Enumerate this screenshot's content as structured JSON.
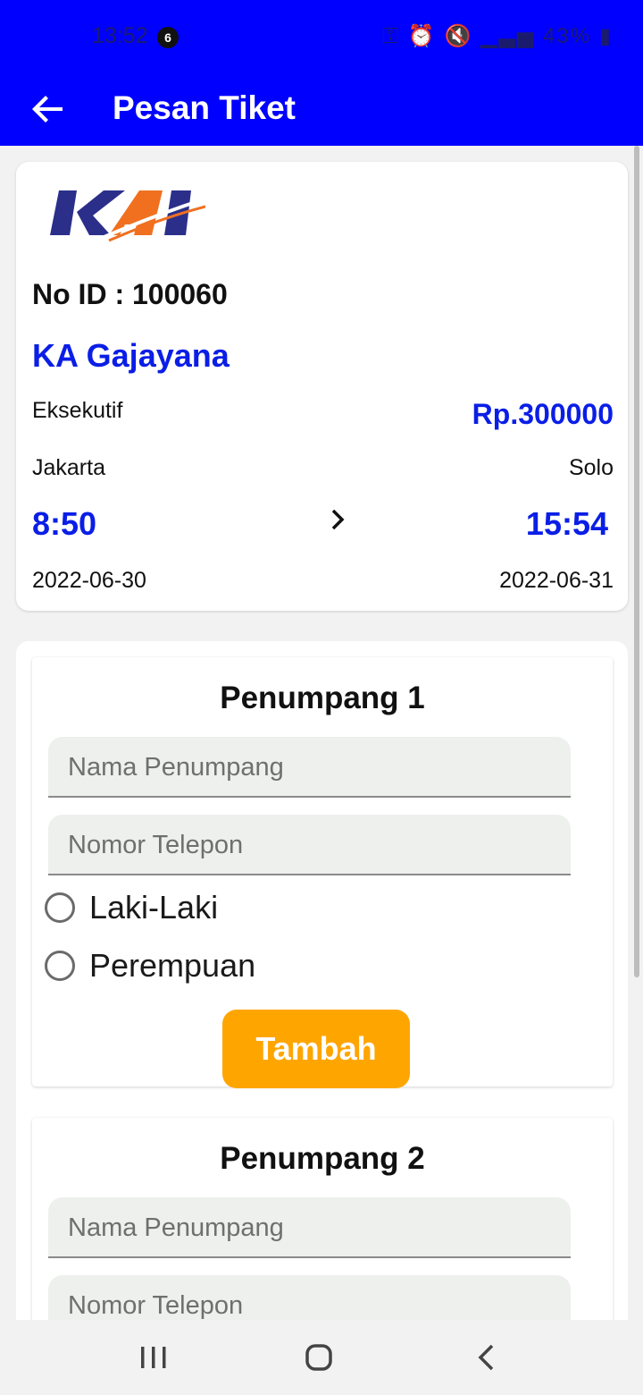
{
  "status_bar": {
    "time": "13:52",
    "notification_count": "6",
    "battery": "43%"
  },
  "app_bar": {
    "title": "Pesan Tiket",
    "back_icon": "arrow-left-icon"
  },
  "ticket": {
    "logo_text": "KAI",
    "id_label": "No ID : 100060",
    "train_name": "KA Gajayana",
    "train_class": "Eksekutif",
    "price": "Rp.300000",
    "origin": "Jakarta",
    "destination": "Solo",
    "depart_time": "8:50",
    "arrive_time": "15:54",
    "depart_date": "2022-06-30",
    "arrive_date": "2022-06-31",
    "arrow_icon": "chevron-right-icon"
  },
  "passengers": [
    {
      "title": "Penumpang 1",
      "name_placeholder": "Nama Penumpang",
      "phone_placeholder": "Nomor Telepon",
      "gender_options": [
        "Laki-Laki",
        "Perempuan"
      ],
      "button_label": "Tambah"
    },
    {
      "title": "Penumpang 2",
      "name_placeholder": "Nama Penumpang",
      "phone_placeholder": "Nomor Telepon"
    }
  ],
  "nav_bar": {
    "icons": [
      "recent-apps-icon",
      "home-icon",
      "back-icon"
    ]
  },
  "colors": {
    "primary": "#0000ff",
    "accent_text": "#0a1ee6",
    "button": "#ffa500",
    "logo_blue": "#2b2f8a",
    "logo_orange": "#f07020"
  }
}
